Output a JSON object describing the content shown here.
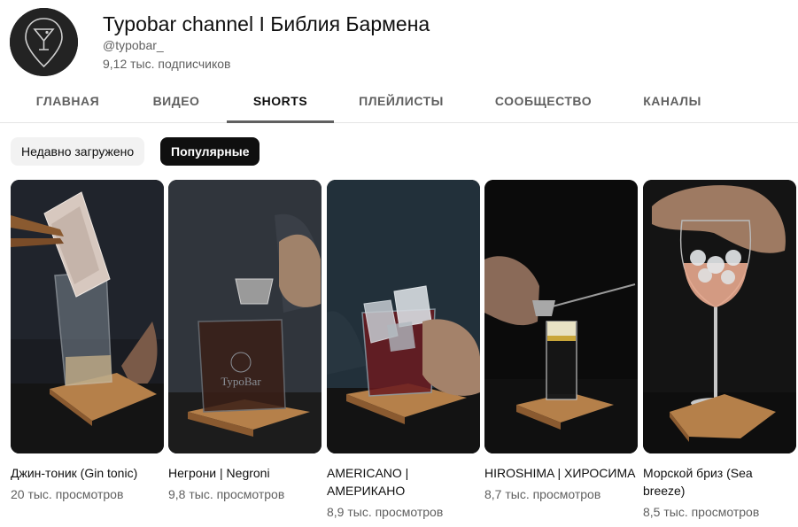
{
  "channel": {
    "name": "Typobar channel I Библия Бармена",
    "handle": "@typobar_",
    "subscribers": "9,12 тыс. подписчиков"
  },
  "tabs": [
    {
      "label": "ГЛАВНАЯ",
      "active": false
    },
    {
      "label": "ВИДЕО",
      "active": false
    },
    {
      "label": "SHORTS",
      "active": true
    },
    {
      "label": "ПЛЕЙЛИСТЫ",
      "active": false
    },
    {
      "label": "СООБЩЕСТВО",
      "active": false
    },
    {
      "label": "КАНАЛЫ",
      "active": false
    }
  ],
  "filters": [
    {
      "label": "Недавно загружено",
      "active": false
    },
    {
      "label": "Популярные",
      "active": true
    }
  ],
  "shorts": [
    {
      "title": "Джин-тоник (Gin tonic)",
      "views": "20 тыс. просмотров",
      "drink_color": "#c9b38a"
    },
    {
      "title": "Негрони | Negroni",
      "views": "9,8 тыс. просмотров",
      "drink_color": "#3a1f17"
    },
    {
      "title": "AMERICANO | АМЕРИКАНО",
      "views": "8,9 тыс. просмотров",
      "drink_color": "#6b1a1f"
    },
    {
      "title": "HIROSHIMA | ХИРОСИМА",
      "views": "8,7 тыс. просмотров",
      "drink_color": "#e8e2c4"
    },
    {
      "title": "Морской бриз (Sea breeze)",
      "views": "8,5 тыс. просмотров",
      "drink_color": "#e8a98e"
    }
  ],
  "thumb_texts": {
    "glass_logo": "TypoBar"
  },
  "colors": {
    "active_chip_bg": "#0f0f0f",
    "inactive_chip_bg": "#f2f2f2",
    "secondary_text": "#606060",
    "coaster_wood": "#b5804a"
  }
}
